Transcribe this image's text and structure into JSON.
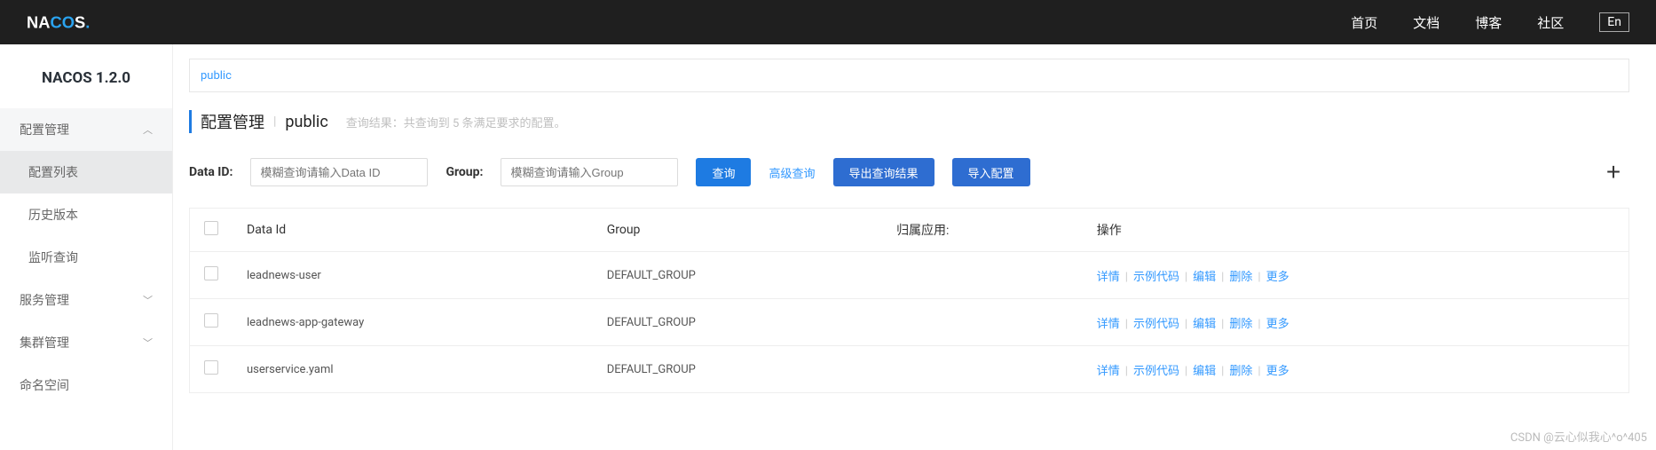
{
  "header": {
    "logo_text": "NACOS.",
    "nav": [
      "首页",
      "文档",
      "博客",
      "社区"
    ],
    "lang": "En"
  },
  "sidebar": {
    "version": "NACOS 1.2.0",
    "groups": [
      {
        "label": "配置管理",
        "expanded": true,
        "children": [
          "配置列表",
          "历史版本",
          "监听查询"
        ]
      },
      {
        "label": "服务管理",
        "expanded": false
      },
      {
        "label": "集群管理",
        "expanded": false
      },
      {
        "label": "命名空间",
        "expanded": null
      }
    ],
    "active_sub": "配置列表"
  },
  "tabs": {
    "active": "public"
  },
  "page": {
    "title": "配置管理",
    "scope": "public",
    "result_hint": "查询结果：共查询到 5 条满足要求的配置。"
  },
  "search": {
    "dataid_label": "Data ID:",
    "dataid_placeholder": "模糊查询请输入Data ID",
    "group_label": "Group:",
    "group_placeholder": "模糊查询请输入Group",
    "query_btn": "查询",
    "advanced_btn": "高级查询",
    "export_btn": "导出查询结果",
    "import_btn": "导入配置"
  },
  "table": {
    "headers": [
      "Data Id",
      "Group",
      "归属应用:",
      "操作"
    ],
    "ops": {
      "detail": "详情",
      "sample": "示例代码",
      "edit": "编辑",
      "delete": "删除",
      "more": "更多"
    },
    "rows": [
      {
        "data_id": "leadnews-user",
        "group": "DEFAULT_GROUP",
        "app": ""
      },
      {
        "data_id": "leadnews-app-gateway",
        "group": "DEFAULT_GROUP",
        "app": ""
      },
      {
        "data_id": "userservice.yaml",
        "group": "DEFAULT_GROUP",
        "app": ""
      }
    ]
  },
  "watermark": "CSDN @云心似我心^o^405"
}
